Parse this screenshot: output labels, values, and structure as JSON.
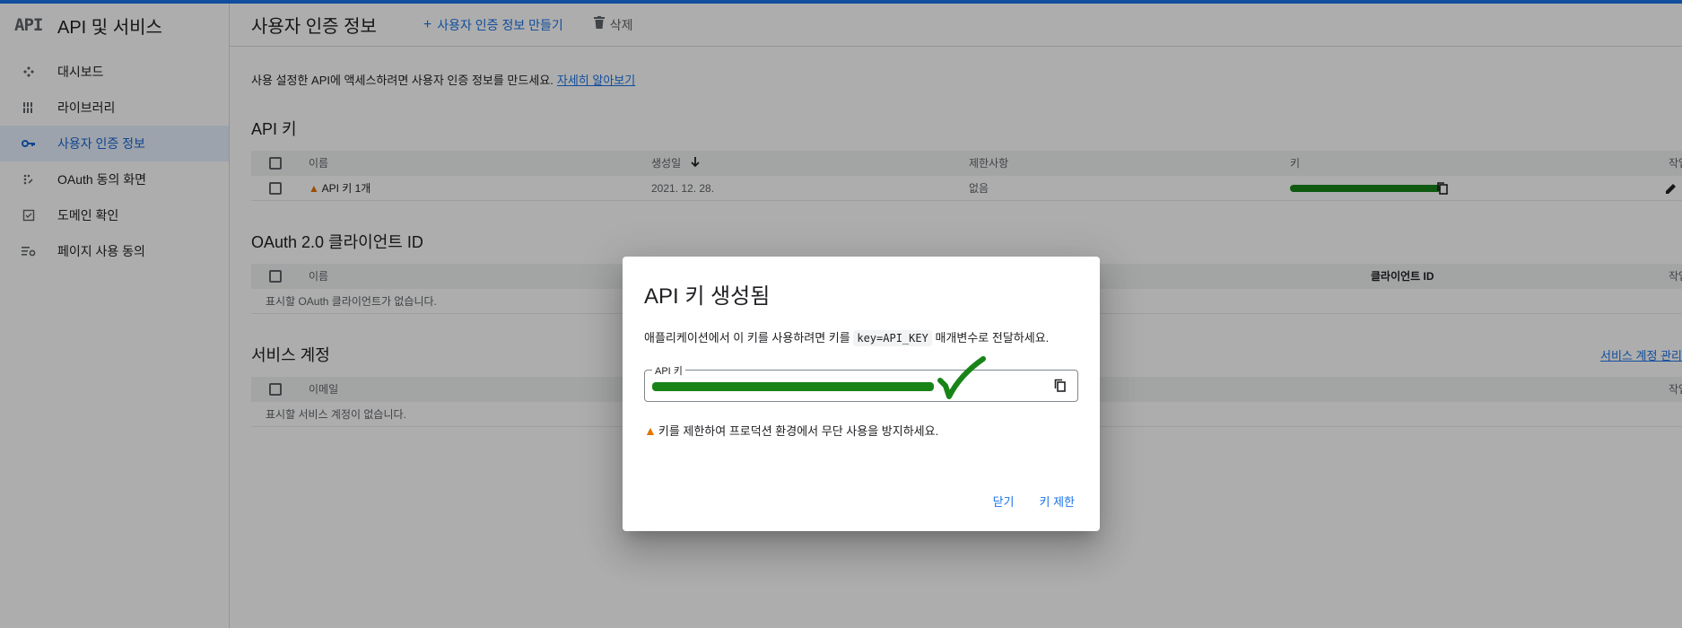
{
  "sidebar": {
    "logo": "API",
    "title": "API 및 서비스",
    "items": [
      {
        "label": "대시보드",
        "icon": "dashboard-icon"
      },
      {
        "label": "라이브러리",
        "icon": "library-icon"
      },
      {
        "label": "사용자 인증 정보",
        "icon": "key-icon",
        "active": true
      },
      {
        "label": "OAuth 동의 화면",
        "icon": "oauth-icon"
      },
      {
        "label": "도메인 확인",
        "icon": "checkbox-icon"
      },
      {
        "label": "페이지 사용 동의",
        "icon": "settings-list-icon"
      }
    ]
  },
  "header": {
    "title": "사용자 인증 정보",
    "create_label": "사용자 인증 정보 만들기",
    "delete_label": "삭제"
  },
  "intro": {
    "text": "사용 설정한 API에 액세스하려면 사용자 인증 정보를 만드세요.",
    "link": "자세히 알아보기"
  },
  "api_keys": {
    "title": "API 키",
    "columns": [
      "이름",
      "생성일",
      "제한사항",
      "키",
      "작업"
    ],
    "rows": [
      {
        "name": "API 키 1개",
        "created": "2021. 12. 28.",
        "restrictions": "없음"
      }
    ]
  },
  "oauth": {
    "title": "OAuth 2.0 클라이언트 ID",
    "columns": [
      "이름",
      "클라이언트 ID",
      "작업"
    ],
    "empty": "표시할 OAuth 클라이언트가 없습니다."
  },
  "service_accounts": {
    "title": "서비스 계정",
    "manage_link": "서비스 계정 관리",
    "columns": [
      "이메일",
      "작업"
    ],
    "empty": "표시할 서비스 계정이 없습니다."
  },
  "dialog": {
    "title": "API 키 생성됨",
    "text_before": "애플리케이션에서 이 키를 사용하려면 키를",
    "code": "key=API_KEY",
    "text_after": "매개변수로 전달하세요.",
    "field_label": "API 키",
    "warning": "키를 제한하여 프로덕션 환경에서 무단 사용을 방지하세요.",
    "close_label": "닫기",
    "restrict_label": "키 제한"
  },
  "colors": {
    "accent": "#1a73e8",
    "warning": "#e37400",
    "redaction": "#188418"
  }
}
